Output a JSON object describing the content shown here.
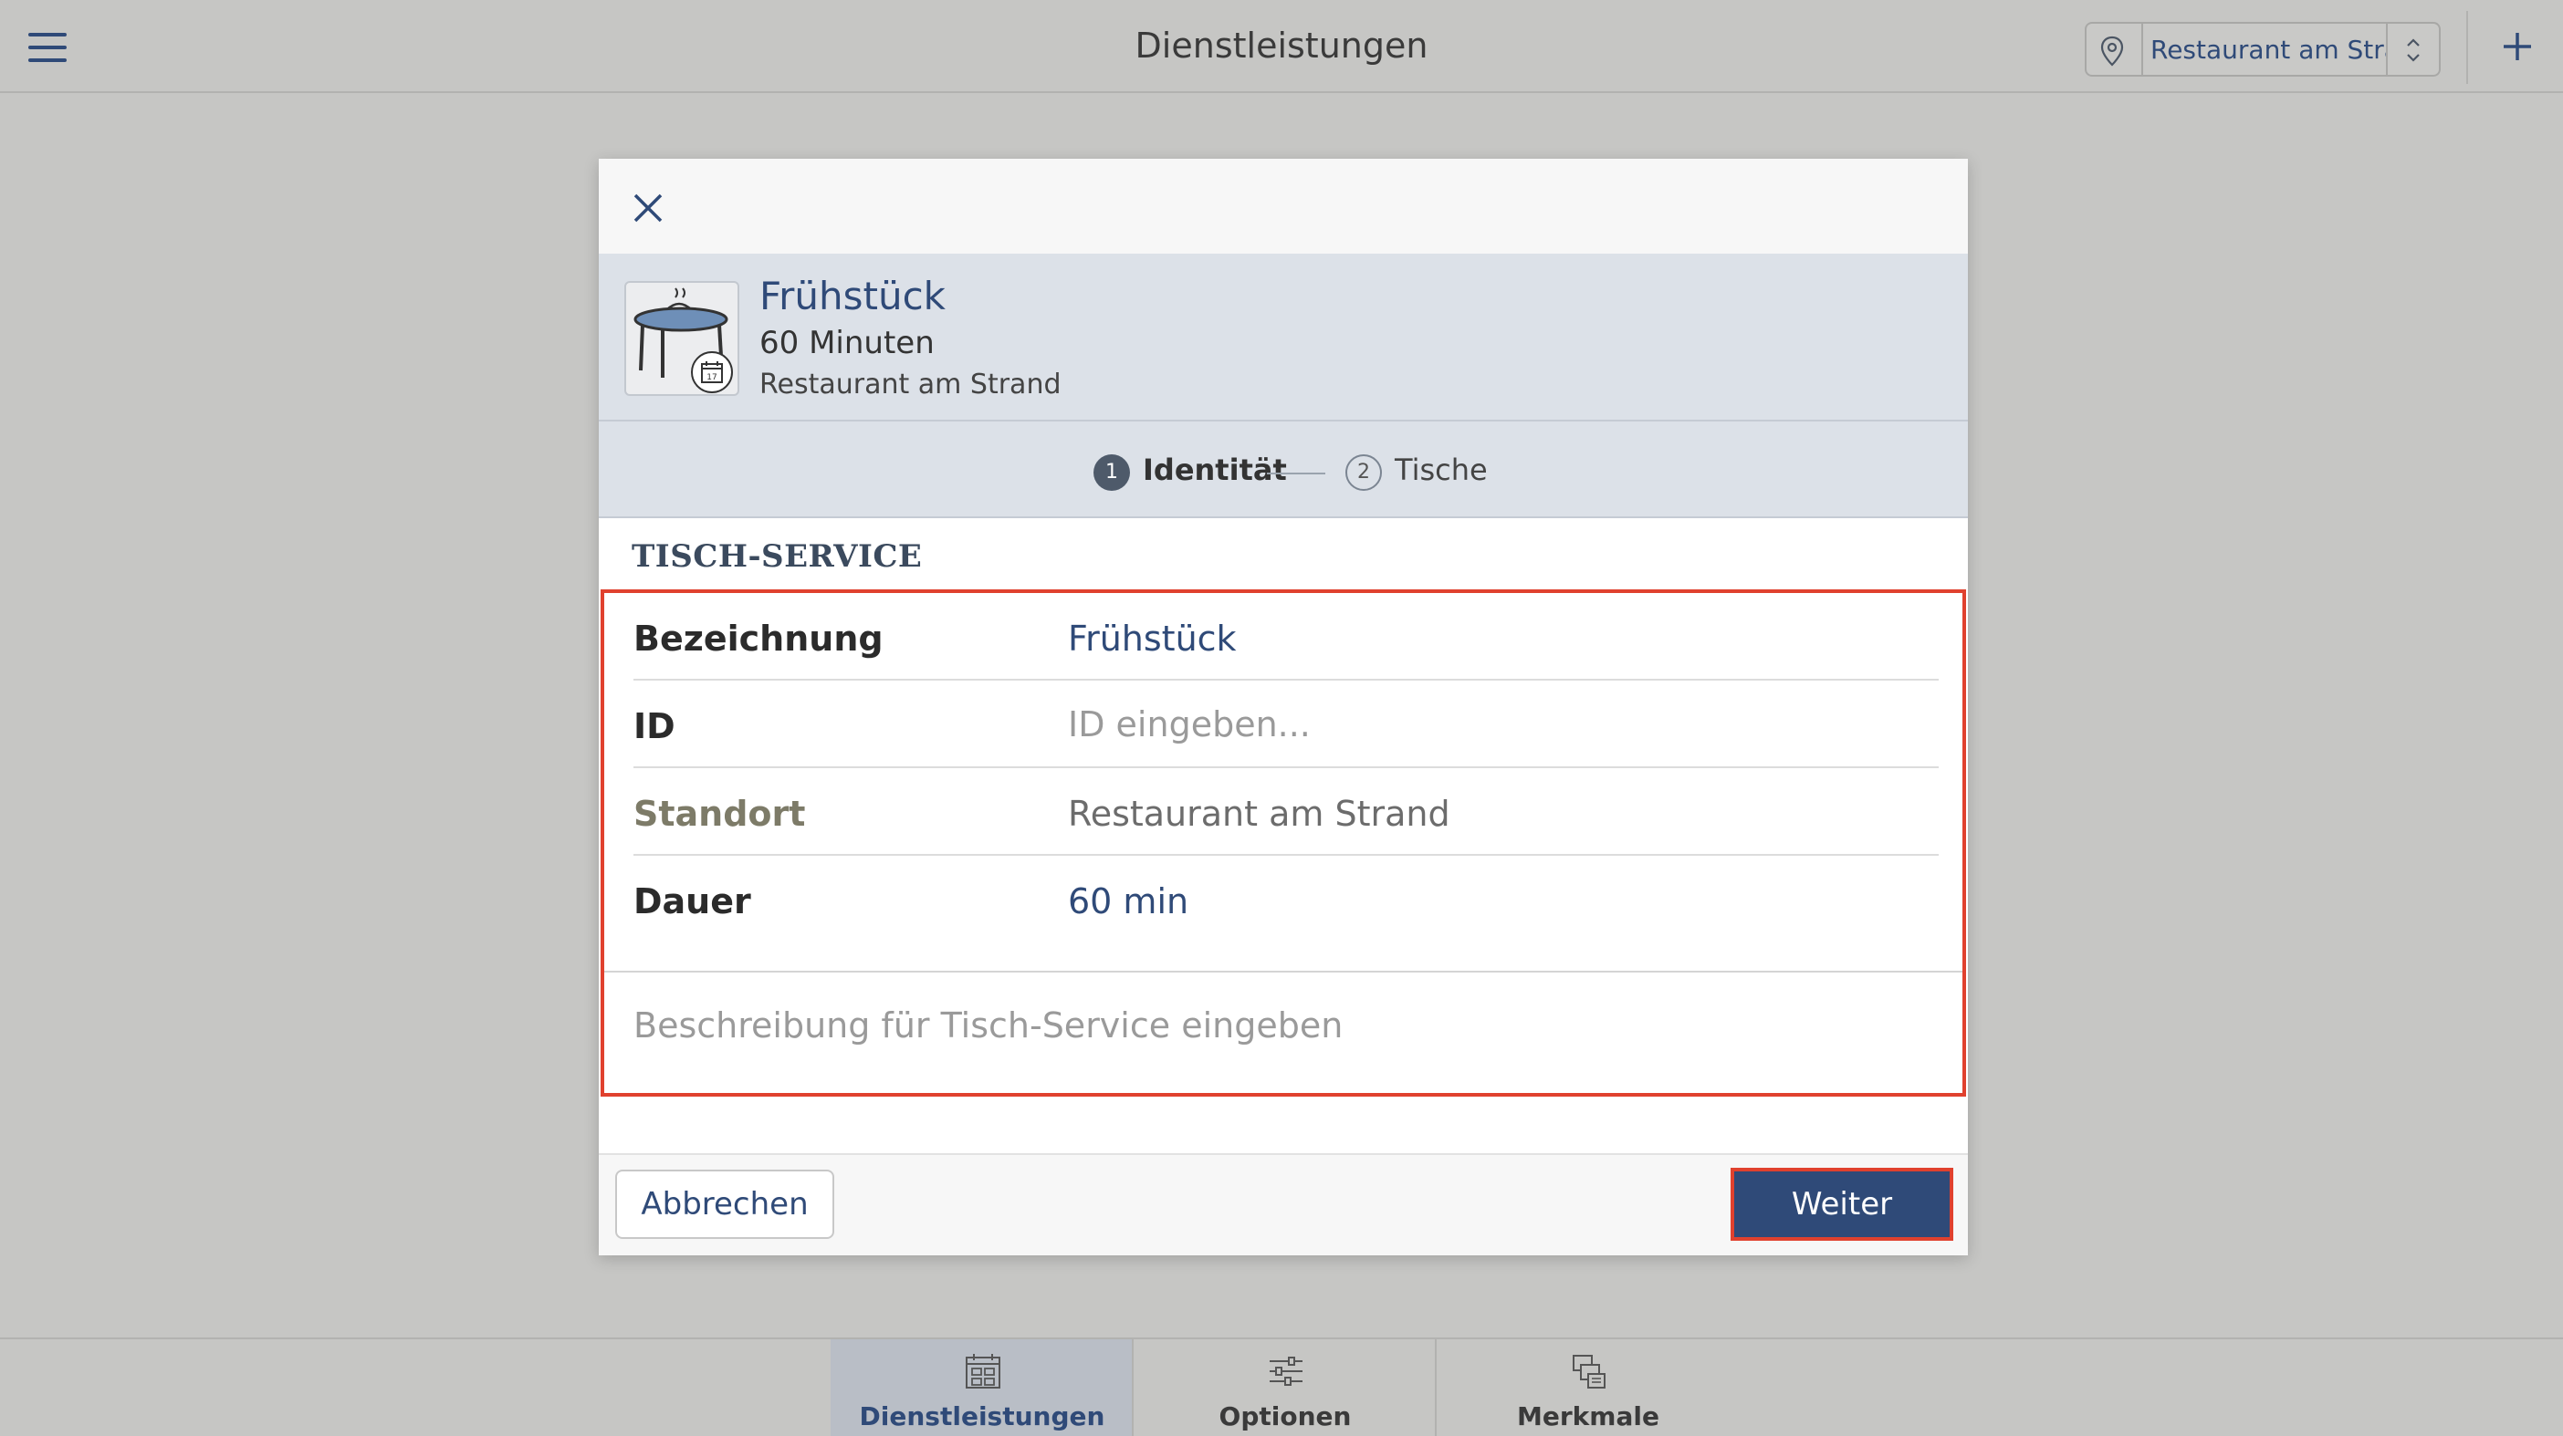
{
  "header": {
    "title": "Dienstleistungen",
    "menu_icon": "hamburger-menu-icon",
    "location_select": {
      "value": "Restaurant am Stra...",
      "icon": "location-pin-icon",
      "chevron_icon": "up-down-chevron-icon"
    },
    "add_icon": "plus-icon"
  },
  "modal": {
    "close_icon": "close-icon",
    "service": {
      "name": "Frühstück",
      "duration": "60 Minuten",
      "location": "Restaurant am Strand",
      "icon": "table-calendar-icon",
      "icon_badge": "17"
    },
    "steps": [
      {
        "number": "1",
        "label": "Identität",
        "active": true
      },
      {
        "number": "2",
        "label": "Tische",
        "active": false
      }
    ],
    "section_title": "TISCH-SERVICE",
    "fields": {
      "name": {
        "label": "Bezeichnung",
        "value": "Frühstück"
      },
      "id": {
        "label": "ID",
        "placeholder": "ID eingeben..."
      },
      "location": {
        "label": "Standort",
        "value": "Restaurant am Strand"
      },
      "duration": {
        "label": "Dauer",
        "value": "60 min"
      }
    },
    "description_placeholder": "Beschreibung für Tisch-Service eingeben",
    "buttons": {
      "cancel": "Abbrechen",
      "next": "Weiter"
    }
  },
  "tabbar": {
    "tabs": [
      {
        "label": "Dienstleistungen",
        "icon": "calendar-grid-icon",
        "active": true
      },
      {
        "label": "Optionen",
        "icon": "sliders-icon",
        "active": false
      },
      {
        "label": "Merkmale",
        "icon": "cubes-icon",
        "active": false
      }
    ]
  },
  "colors": {
    "accent": "#2f4a78",
    "highlight_border": "#e0412e",
    "overlay_background": "#c6c6c4"
  }
}
